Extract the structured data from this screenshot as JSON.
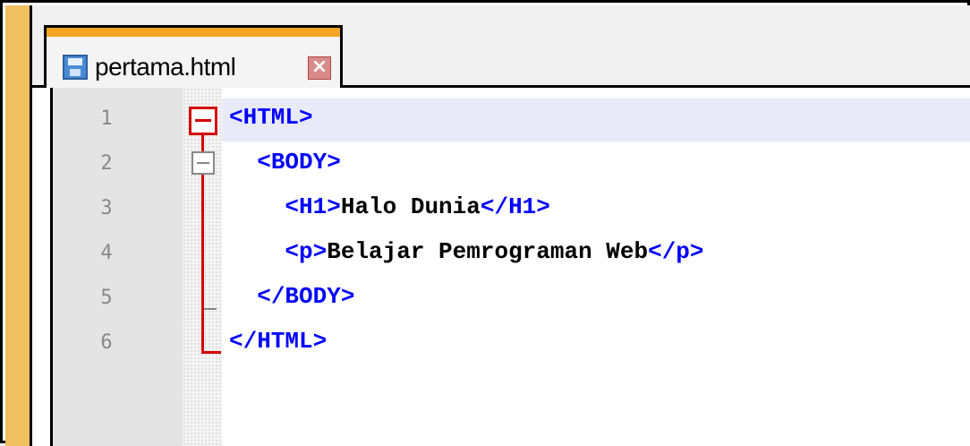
{
  "tab": {
    "filename": "pertama.html",
    "close_icon": "close-icon",
    "file_icon": "floppy-disk-icon"
  },
  "editor": {
    "line_numbers": [
      "1",
      "2",
      "3",
      "4",
      "5",
      "6"
    ],
    "lines": [
      {
        "indent": "",
        "parts": [
          {
            "t": "<HTML>",
            "k": "tag"
          }
        ]
      },
      {
        "indent": "  ",
        "parts": [
          {
            "t": "<BODY>",
            "k": "tag"
          }
        ]
      },
      {
        "indent": "    ",
        "parts": [
          {
            "t": "<H1>",
            "k": "tag"
          },
          {
            "t": "Halo Dunia",
            "k": "text"
          },
          {
            "t": "</H1>",
            "k": "tag"
          }
        ]
      },
      {
        "indent": "    ",
        "parts": [
          {
            "t": "<p>",
            "k": "tag"
          },
          {
            "t": "Belajar Pemrograman Web",
            "k": "text"
          },
          {
            "t": "</p>",
            "k": "tag"
          }
        ]
      },
      {
        "indent": "  ",
        "parts": [
          {
            "t": "</BODY>",
            "k": "tag"
          }
        ]
      },
      {
        "indent": "",
        "parts": [
          {
            "t": "</HTML>",
            "k": "tag"
          }
        ]
      }
    ],
    "current_line": 1
  },
  "colors": {
    "tag": "#0000ff",
    "text": "#000000",
    "fold_marker": "#d40000",
    "tab_accent": "#f5a623"
  }
}
